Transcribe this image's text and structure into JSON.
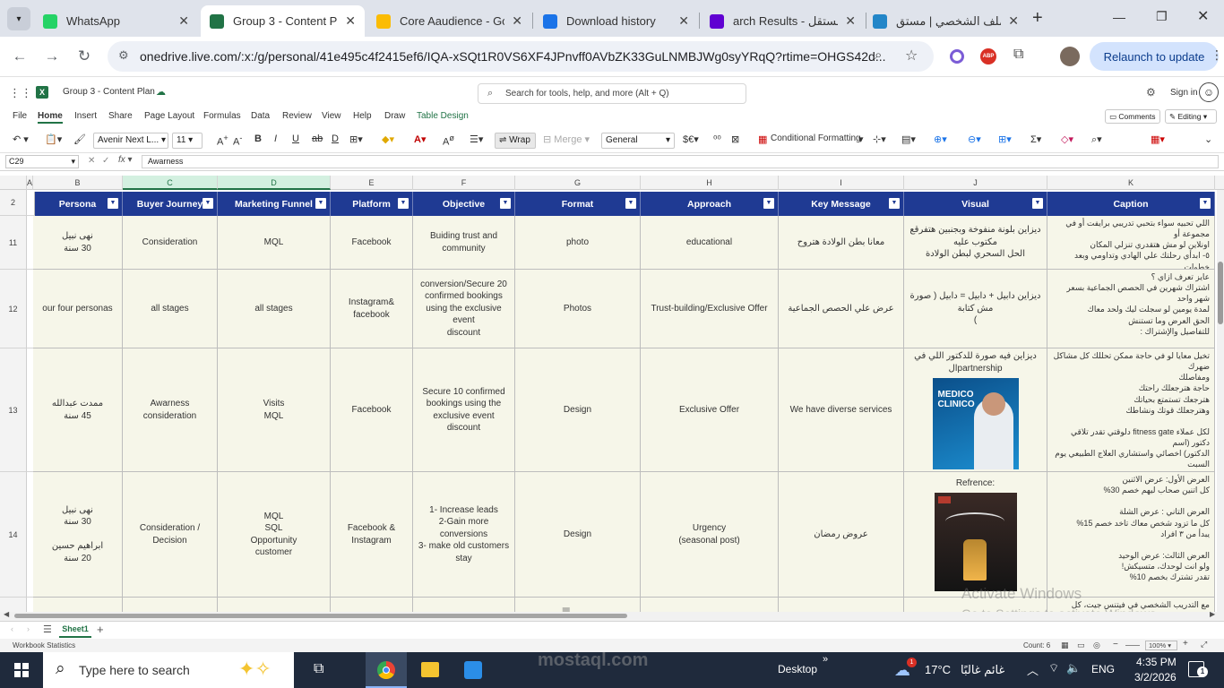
{
  "browser": {
    "tabs": [
      {
        "label": "WhatsApp",
        "icon": "whatsapp-icon",
        "color": "#25d366",
        "active": false
      },
      {
        "label": "Group 3 - Content Pla",
        "icon": "excel-icon",
        "color": "#217346",
        "active": true
      },
      {
        "label": "Core Aaudience - Goo",
        "icon": "drive-icon",
        "color": "#fbbc04",
        "active": false
      },
      {
        "label": "Download history",
        "icon": "download-icon",
        "color": "#1a73e8",
        "active": false
      },
      {
        "label": "arch Results - مستقل",
        "icon": "yahoo-icon",
        "color": "#6001d2",
        "active": false
      },
      {
        "label": "الملف الشخصي | مستق",
        "icon": "mostaql-icon",
        "color": "#2386c8",
        "active": false
      }
    ],
    "url": "onedrive.live.com/:x:/g/personal/41e495c4f2415ef6/IQA-xSQt1R0VS6XF4JPnvff0AVbZK33GuLNMBJWg0syYRqQ?rtime=OHGS42d...",
    "relaunch_label": "Relaunch to update"
  },
  "excel": {
    "doc_title": "Group 3 - Content Plan",
    "search_placeholder": "Search for tools, help, and more (Alt + Q)",
    "signin": "Sign in",
    "menus": [
      "File",
      "Home",
      "Insert",
      "Share",
      "Page Layout",
      "Formulas",
      "Data",
      "Review",
      "View",
      "Help",
      "Draw",
      "Table Design"
    ],
    "comments": "Comments",
    "editing": "Editing",
    "font_name": "Avenir Next L...",
    "font_size": "11",
    "wrap": "Wrap",
    "merge": "Merge",
    "number_format": "General",
    "cond_format": "Conditional Formatting",
    "cell_ref": "C29",
    "formula": "Awarness",
    "sheet": "Sheet1",
    "status_left": "Workbook Statistics",
    "status_count": "Count: 6",
    "zoom": "100%"
  },
  "columns": [
    "A",
    "B",
    "C",
    "D",
    "E",
    "F",
    "G",
    "H",
    "I",
    "J",
    "K"
  ],
  "table": {
    "headers": [
      "Persona",
      "Buyer Journey",
      "Marketing Funnel",
      "Platform",
      "Objective",
      "Format",
      "Approach",
      "Key Message",
      "Visual",
      "Caption"
    ],
    "rows": [
      {
        "num": "11",
        "cells": [
          "نهى نبيل\n30 سنة",
          "Consideration",
          "MQL",
          "Facebook",
          "Buiding trust and\ncommunity",
          "photo",
          "educational",
          "معانا بطن الولادة هتروح",
          "ديزاين بلونة منفوخة وبجنبين هتفرقع مكتوب عليه\nالحل السحري لبطن الولادة",
          "اللي تحبيه سواء بتحبي تدريبي برايفت أو في مجموعة أو\nاونلاين لو مش هتقدري تنزلي المكان\n٥- ابدأي رحلتك علي الهادي وتداومي وبعد خطوات\nصغيرة كتير هتوصلي ، ما تستعجليش علي النتيجة"
        ]
      },
      {
        "num": "12",
        "cells": [
          "our four personas",
          "all stages",
          "all stages",
          "Instagram&\nfacebook",
          "conversion/Secure 20\nconfirmed bookings\nusing the exclusive event\ndiscount",
          "Photos",
          "Trust-building/Exclusive Offer",
          "عرض علي الحصص الجماعية",
          "ديزاين دابيل + دابيل = دابيل ( صورة مش كتابة\n)",
          "عايز تعرف ازاي ؟\nاشتراك شهرين في الحصص الجماعية بسعر شهر واحد\nلمدة يومين لو سجلت ليك ولحد معاك\nالحق العرض وما تستنش\nللتفاصيل والإشتراك :"
        ]
      },
      {
        "num": "13",
        "cells": [
          "ممدت عبدالله\n45 سنة",
          "Awarness\nconsideration",
          "Visits\nMQL",
          "Facebook",
          "Secure 10 confirmed\nbookings using the\nexclusive event discount",
          "Design",
          "Exclusive Offer",
          "We have diverse services",
          "ديزاين فيه صورة للدكتور اللي في\npartnershipال",
          "تخيل معايا لو في حاجة ممكن تحللك كل مشاكل ضهرك\nومفاصلك\nحاجة هترجعلك راحتك\nهترجعك تستمتع بحياتك\nوهترجعلك قوتك ونشاطك\n\nلكل عملاء fitness gate دلوقتي تقدر تلاقي دكتور (اسم\nالدكتور) اخصائي واستشاري العلاج الطبيعي يوم السبت\nوالتلات"
        ]
      },
      {
        "num": "14",
        "cells": [
          "نهى نبيل\n30 سنة\n\nابراهيم حسين\n20 سنة",
          "Consideration / Decision",
          "MQL\nSQL\nOpportunity\ncustomer",
          "Facebook &\nInstagram",
          "1- Increase leads\n2-Gain more\nconversions\n3- make old customers\nstay",
          "Design",
          "Urgency\n(seasonal post)",
          "عروض رمضان",
          "Refrence:",
          "العرض الأول: عرض الاثنين\nكل اتنين صحاب ليهم خصم 30%\n\nالعرض التاني : عرض الشلة\nكل ما تزود شخص معاك تاخد خصم 15%\nيبدأ من ٣ افراد\n\nالعرض الثالث: عرض الوحيد\nولو انت لوحدك، متسيكش!\nتقدر تشترك بخصم 10%"
        ]
      }
    ],
    "visual_13_image_text": "MEDICO\nCLINICO",
    "row15_caption": "مع التدريب الشخصي في فيتنس جيت، كل تمرينة معمولة"
  },
  "watermark": {
    "line1": "Activate Windows",
    "line2": "Go to Settings to activate Windows.",
    "site_ar": "مستقل",
    "site": "mostaql.com"
  },
  "taskbar": {
    "search_placeholder": "Type here to search",
    "desktop": "Desktop",
    "weather_temp": "17°C",
    "weather_text": "غائم غالبًا",
    "lang": "ENG",
    "time": "4:35 PM",
    "date": "3/2/2026",
    "notif_count": "1"
  }
}
